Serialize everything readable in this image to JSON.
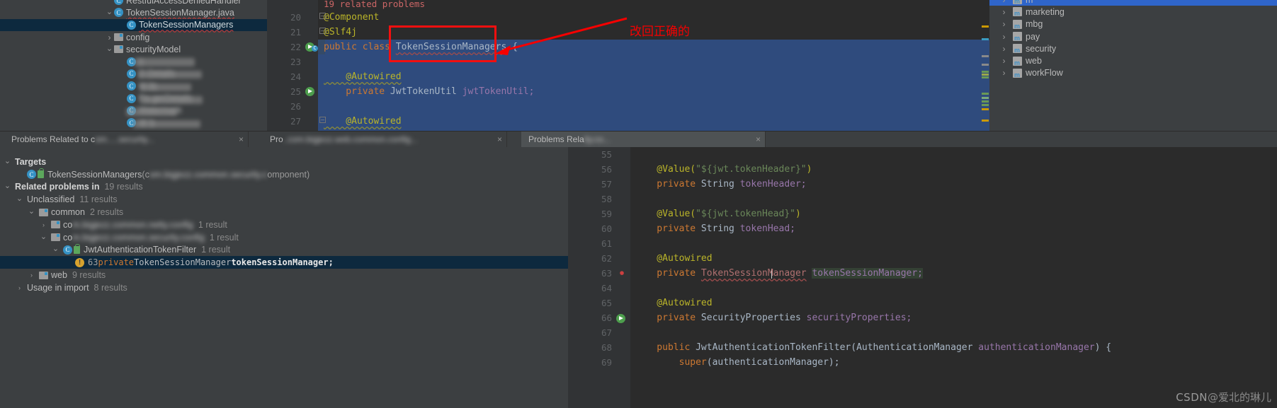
{
  "project_tree": {
    "name": "project-files-tree",
    "items": [
      {
        "indent": 0,
        "twisty": "",
        "icon": "class-icon",
        "label": "RestfulAccessDeniedHandler",
        "selected": false,
        "clipped_top": true
      },
      {
        "indent": 0,
        "twisty": "v",
        "icon": "class-icon",
        "label": "TokenSessionManager.java",
        "selected": false,
        "wavy": true
      },
      {
        "indent": 1,
        "twisty": "",
        "icon": "class-icon",
        "label": "TokenSessionManagers",
        "selected": true,
        "wavy": true
      },
      {
        "indent": 0,
        "twisty": ">",
        "icon": "folder-icon",
        "label": "config",
        "selected": false
      },
      {
        "indent": 0,
        "twisty": "v",
        "icon": "folder-icon",
        "label": "securityModel",
        "selected": false
      },
      {
        "indent": 1,
        "twisty": "",
        "icon": "class-icon",
        "label": "s",
        "selected": false,
        "blurred": true
      },
      {
        "indent": 1,
        "twisty": "",
        "icon": "class-icon",
        "label": "D         Details",
        "selected": false,
        "blurred": true
      },
      {
        "indent": 1,
        "twisty": "",
        "icon": "class-icon",
        "label": "M        ils",
        "selected": false,
        "blurred": true
      },
      {
        "indent": 1,
        "twisty": "",
        "icon": "class-icon",
        "label": "Pa     gerDetails",
        "selected": false,
        "blurred": true
      },
      {
        "indent": 1,
        "twisty": "",
        "icon": "class-icon",
        "label": "Watermark",
        "selected": false,
        "blurred": true
      },
      {
        "indent": 1,
        "twisty": "",
        "icon": "class-icon",
        "label": "W                        b",
        "selected": false,
        "blurred": true
      }
    ]
  },
  "editor_top": {
    "name": "code-editor-top",
    "problems_banner": "19 related problems",
    "lines": [
      {
        "num": "20",
        "fold": true,
        "gutter": "",
        "segments": [
          {
            "t": "@Component",
            "c": "k-ann"
          }
        ]
      },
      {
        "num": "21",
        "fold": true,
        "gutter": "",
        "segments": [
          {
            "t": "@Slf4j",
            "c": "k-ann"
          }
        ]
      },
      {
        "num": "22",
        "fold": false,
        "gutter": "class-run-icon",
        "segments": [
          {
            "t": "public class ",
            "c": "k-kw"
          },
          {
            "t": "TokenSessionManagers",
            "c": "k-cls wavy-r"
          },
          {
            "t": " {",
            "c": "k-txt"
          }
        ]
      },
      {
        "num": "23",
        "fold": false,
        "gutter": "",
        "segments": []
      },
      {
        "num": "24",
        "fold": false,
        "gutter": "",
        "segments": [
          {
            "t": "    @Autowired",
            "c": "k-ann wavy-y"
          }
        ]
      },
      {
        "num": "25",
        "fold": false,
        "gutter": "run-icon",
        "segments": [
          {
            "t": "    private ",
            "c": "k-kw"
          },
          {
            "t": "JwtTokenUtil ",
            "c": "k-type"
          },
          {
            "t": "jwtTokenUtil;",
            "c": "k-fld"
          }
        ]
      },
      {
        "num": "26",
        "fold": false,
        "gutter": "",
        "segments": []
      },
      {
        "num": "27",
        "fold": true,
        "gutter": "",
        "segments": [
          {
            "t": "    @Autowired",
            "c": "k-ann wavy-y"
          }
        ]
      }
    ]
  },
  "annotation": {
    "name": "red-callout",
    "text": "改回正确的",
    "color": "#f50000",
    "box_label": "TokenSessionManagers"
  },
  "maven_panel": {
    "name": "maven-modules-panel",
    "items": [
      {
        "label": "m",
        "selected": true,
        "clipped": true
      },
      {
        "label": "marketing",
        "selected": false
      },
      {
        "label": "mbg",
        "selected": false
      },
      {
        "label": "pay",
        "selected": false
      },
      {
        "label": "security",
        "selected": false
      },
      {
        "label": "web",
        "selected": false
      },
      {
        "label": "workFlow",
        "selected": false
      }
    ]
  },
  "tabs": {
    "name": "problems-tab-bar",
    "items": [
      {
        "label": "Problems Related to c",
        "blurred_tail": "om.....security...",
        "active": false,
        "close": "×"
      },
      {
        "label": "Pro",
        "blurred_tail": "..com.bigjezz.web.common.config...",
        "active": false,
        "close": "×"
      },
      {
        "label": "Problems Rela",
        "blurred_tail": "ity.co...",
        "active": true,
        "close": "×"
      }
    ]
  },
  "problems_tree": {
    "name": "related-problems-tree",
    "rows": [
      {
        "indent": 0,
        "twisty": "v",
        "icon": "none",
        "bold": "Targets",
        "dim": ""
      },
      {
        "indent": 1,
        "twisty": "",
        "icon": "class-lock",
        "text": "TokenSessionManagers",
        "paren_pre": " (c",
        "paren_blur": true,
        "paren_post": "omponent)"
      },
      {
        "indent": 0,
        "twisty": "v",
        "icon": "none",
        "bold": "Related problems in",
        "dim": "19 results"
      },
      {
        "indent": 1,
        "twisty": "v",
        "icon": "none",
        "text": "Unclassified",
        "dim": "11 results"
      },
      {
        "indent": 2,
        "twisty": "v",
        "icon": "folder",
        "text": "common",
        "dim": "2 results"
      },
      {
        "indent": 3,
        "twisty": ">",
        "icon": "folder",
        "text": "co",
        "blurred_mid": "m.bigjezz.common.netty.config",
        "dim": "1 result"
      },
      {
        "indent": 3,
        "twisty": "v",
        "icon": "folder",
        "text": "co",
        "blurred_mid": "m.bigjezz.common.security.config",
        "dim": "1 result"
      },
      {
        "indent": 4,
        "twisty": "v",
        "icon": "class-lock",
        "text": "JwtAuthenticationTokenFilter",
        "dim": "1 result"
      },
      {
        "indent": 5,
        "twisty": "",
        "icon": "err",
        "lineno": "63",
        "code_pre": "private ",
        "code_type": "TokenSessionManager ",
        "code_field": "tokenSessionManager;",
        "selected": true
      },
      {
        "indent": 2,
        "twisty": ">",
        "icon": "folder",
        "text": "web",
        "dim": "9 results"
      },
      {
        "indent": 1,
        "twisty": ">",
        "icon": "none",
        "text": "Usage in import",
        "dim": "8 results"
      }
    ]
  },
  "editor_bottom": {
    "name": "code-editor-bottom",
    "lines": [
      {
        "num": "55",
        "err": false,
        "gutter": "",
        "segments": []
      },
      {
        "num": "56",
        "err": false,
        "gutter": "",
        "segments": [
          {
            "t": "    @Value(",
            "c": "k-ann"
          },
          {
            "t": "\"${jwt.tokenHeader}\"",
            "c": "k-str"
          },
          {
            "t": ")",
            "c": "k-ann"
          }
        ]
      },
      {
        "num": "57",
        "err": false,
        "gutter": "",
        "segments": [
          {
            "t": "    private ",
            "c": "k-kw"
          },
          {
            "t": "String ",
            "c": "k-type"
          },
          {
            "t": "tokenHeader;",
            "c": "k-fld"
          }
        ]
      },
      {
        "num": "58",
        "err": false,
        "gutter": "",
        "segments": []
      },
      {
        "num": "59",
        "err": false,
        "gutter": "",
        "segments": [
          {
            "t": "    @Value(",
            "c": "k-ann"
          },
          {
            "t": "\"${jwt.tokenHead}\"",
            "c": "k-str"
          },
          {
            "t": ")",
            "c": "k-ann"
          }
        ]
      },
      {
        "num": "60",
        "err": false,
        "gutter": "",
        "segments": [
          {
            "t": "    private ",
            "c": "k-kw"
          },
          {
            "t": "String ",
            "c": "k-type"
          },
          {
            "t": "tokenHead;",
            "c": "k-fld"
          }
        ]
      },
      {
        "num": "61",
        "err": false,
        "gutter": "",
        "segments": []
      },
      {
        "num": "62",
        "err": false,
        "gutter": "",
        "segments": [
          {
            "t": "    @Autowired",
            "c": "k-ann"
          }
        ]
      },
      {
        "num": "63",
        "err": true,
        "gutter": "",
        "segments": [
          {
            "t": "    private ",
            "c": "k-kw"
          },
          {
            "t": "TokenSessionManager",
            "c": "k-warn-red wavy-r"
          },
          {
            "t": " ",
            "c": "k-txt"
          },
          {
            "t": "tokenSessionManager;",
            "c": "k-fld hl-ident"
          }
        ]
      },
      {
        "num": "64",
        "err": false,
        "gutter": "",
        "segments": []
      },
      {
        "num": "65",
        "err": false,
        "gutter": "",
        "segments": [
          {
            "t": "    @Autowired",
            "c": "k-ann"
          }
        ]
      },
      {
        "num": "66",
        "err": false,
        "gutter": "run-icon",
        "segments": [
          {
            "t": "    private ",
            "c": "k-kw"
          },
          {
            "t": "SecurityProperties ",
            "c": "k-type"
          },
          {
            "t": "securityProperties;",
            "c": "k-fld"
          }
        ]
      },
      {
        "num": "67",
        "err": false,
        "gutter": "",
        "segments": []
      },
      {
        "num": "68",
        "err": false,
        "gutter": "",
        "segments": [
          {
            "t": "    public ",
            "c": "k-kw"
          },
          {
            "t": "JwtAuthenticationTokenFilter",
            "c": "k-cls"
          },
          {
            "t": "(",
            "c": "k-txt"
          },
          {
            "t": "AuthenticationManager ",
            "c": "k-type"
          },
          {
            "t": "authenticationManager",
            "c": "k-fld"
          },
          {
            "t": ") {",
            "c": "k-txt"
          }
        ]
      },
      {
        "num": "69",
        "err": false,
        "gutter": "",
        "segments": [
          {
            "t": "        super",
            "c": "k-kw"
          },
          {
            "t": "(authenticationManager);",
            "c": "k-txt"
          }
        ]
      }
    ]
  },
  "watermark": {
    "name": "csdn-watermark",
    "brand": "CSDN",
    "author": "@爱北的琳儿"
  },
  "colors": {
    "editor_bg": "#2b2b2b",
    "panel_bg": "#3c3f41",
    "selection_blue": "#2f4b7d",
    "tree_selection": "#0d293e",
    "annotation_red": "#f50000",
    "gutter_bg": "#313335"
  }
}
